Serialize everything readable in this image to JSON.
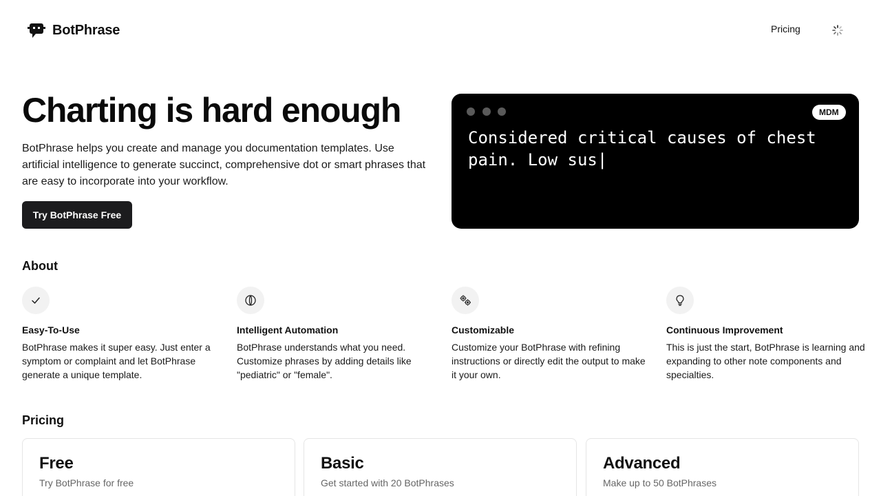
{
  "header": {
    "brand_name": "BotPhrase",
    "nav_pricing": "Pricing",
    "logo_icon": "chat-bot-icon",
    "loader_icon": "loading-spinner-icon"
  },
  "hero": {
    "title": "Charting is hard enough",
    "subtitle": "BotPhrase helps you create and manage you documentation templates. Use artificial intelligence to generate succinct, comprehensive dot or smart phrases that are easy to incorporate into your workflow.",
    "cta_label": "Try BotPhrase Free"
  },
  "terminal": {
    "badge": "MDM",
    "text": "Considered critical causes of chest pain. Low sus|"
  },
  "about": {
    "heading": "About",
    "features": [
      {
        "icon": "check-icon",
        "title": "Easy-To-Use",
        "description": "BotPhrase makes it super easy. Just enter a symptom or complaint and let BotPhrase generate a unique template."
      },
      {
        "icon": "brain-icon",
        "title": "Intelligent Automation",
        "description": "BotPhrase understands what you need. Customize phrases by adding details like \"pediatric\" or \"female\"."
      },
      {
        "icon": "cogs-icon",
        "title": "Customizable",
        "description": "Customize your BotPhrase with refining instructions or directly edit the output to make it your own."
      },
      {
        "icon": "lightbulb-icon",
        "title": "Continuous Improvement",
        "description": "This is just the start, BotPhrase is learning and expanding to other note components and specialties."
      }
    ]
  },
  "pricing": {
    "heading": "Pricing",
    "plans": [
      {
        "name": "Free",
        "description": "Try BotPhrase for free"
      },
      {
        "name": "Basic",
        "description": "Get started with 20 BotPhrases"
      },
      {
        "name": "Advanced",
        "description": "Make up to 50 BotPhrases"
      }
    ]
  },
  "colors": {
    "background": "#ffffff",
    "text": "#111111",
    "cta_bg": "#1c1c1e",
    "terminal_bg": "#000000",
    "terminal_dot": "#5a5a5a",
    "icon_circle": "#f2f2f2",
    "muted_text": "#666666",
    "card_border": "#e5e5e5"
  }
}
